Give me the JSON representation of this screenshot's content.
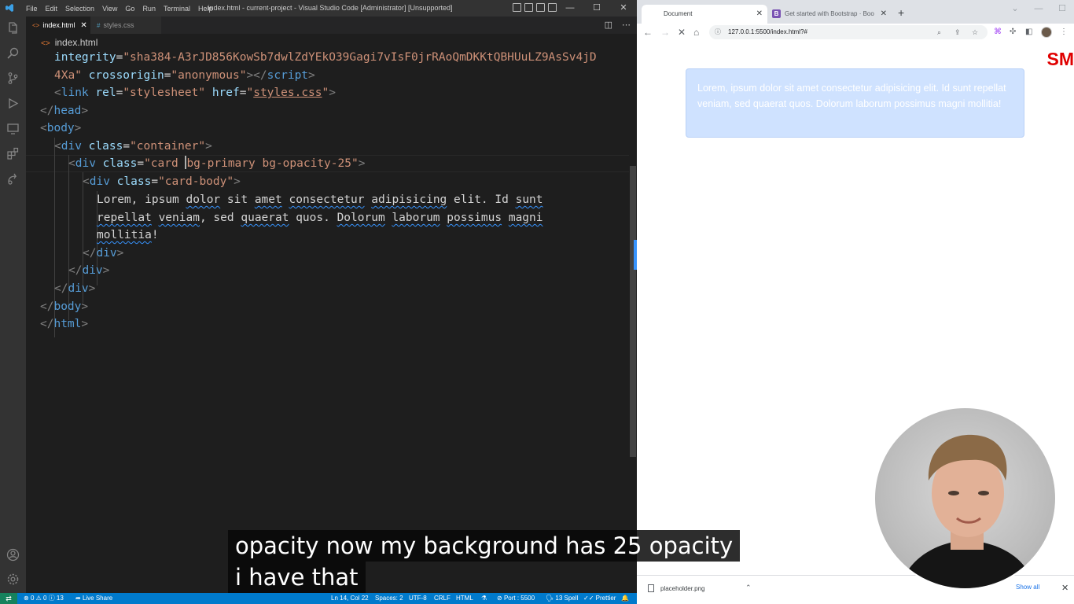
{
  "vscode": {
    "menu": [
      "File",
      "Edit",
      "Selection",
      "View",
      "Go",
      "Run",
      "Terminal",
      "Help"
    ],
    "window_title": "index.html - current-project - Visual Studio Code [Administrator] [Unsupported]",
    "tabs": [
      {
        "label": "index.html",
        "icon": "html-file-icon",
        "active": true
      },
      {
        "label": "styles.css",
        "icon": "css-file-icon",
        "active": false
      }
    ],
    "breadcrumb": "index.html",
    "code": {
      "l1_attr": "integrity",
      "l1_val": "\"sha384-A3rJD856KowSb7dwlZdYEkO39Gagi7vIsF0jrRAoQmDKKtQBHUuLZ9AsSv4jD",
      "l2_val": "4Xa\"",
      "l2_attr": "crossorigin",
      "l2_val2": "\"anonymous\"",
      "l2_tag": "script",
      "l3_tag": "link",
      "l3_attr1": "rel",
      "l3_val1": "\"stylesheet\"",
      "l3_attr2": "href",
      "l3_val2": "styles.css",
      "l4_tag": "head",
      "l5_tag": "body",
      "l6_tag": "div",
      "l6_attr": "class",
      "l6_val": "\"container\"",
      "l7_tag": "div",
      "l7_attr": "class",
      "l7_val_a": "\"card ",
      "l7_val_b": "bg-primary bg-opacity-25\"",
      "l8_tag": "div",
      "l8_attr": "class",
      "l8_val": "\"card-body\"",
      "l9": [
        "Lorem",
        ", ",
        "ipsum",
        " ",
        "dolor",
        " sit ",
        "amet",
        " ",
        "consectetur",
        " ",
        "adipisicing",
        " elit. Id ",
        "sunt"
      ],
      "l10": [
        "repellat",
        " ",
        "veniam",
        ", sed ",
        "quaerat",
        " quos. ",
        "Dolorum",
        " ",
        "laborum",
        " ",
        "possimus",
        " ",
        "magni"
      ],
      "l11": "mollitia",
      "l11_end": "!",
      "l12_tag": "div",
      "l13_tag": "div",
      "l14_tag": "div",
      "l15_tag": "body",
      "l16_tag": "html"
    },
    "status": {
      "errors": "0",
      "warnings": "0",
      "infos": "13",
      "live_share": "Live Share",
      "position": "Ln 14, Col 22",
      "spaces": "Spaces: 2",
      "encoding": "UTF-8",
      "eol": "CRLF",
      "language": "HTML",
      "port": "Port : 5500",
      "spell": "13 Spell",
      "prettier": "Prettier"
    }
  },
  "browser": {
    "tabs": [
      {
        "label": "Document",
        "active": true
      },
      {
        "label": "Get started with Bootstrap · Boo",
        "active": false
      }
    ],
    "bs_favicon": "B",
    "url": "127.0.0.1:5500/index.html?#",
    "card_text": "Lorem, ipsum dolor sit amet consectetur adipisicing elit. Id sunt repellat veniam, sed quaerat quos. Dolorum laborum possimus magni mollitia!",
    "card_bg": "#cfe2ff",
    "brand_text": "SM",
    "download_file": "placeholder.png",
    "show_all": "Show all"
  },
  "caption": {
    "line1": "opacity now my background has 25 opacity",
    "line2": "i have that"
  }
}
